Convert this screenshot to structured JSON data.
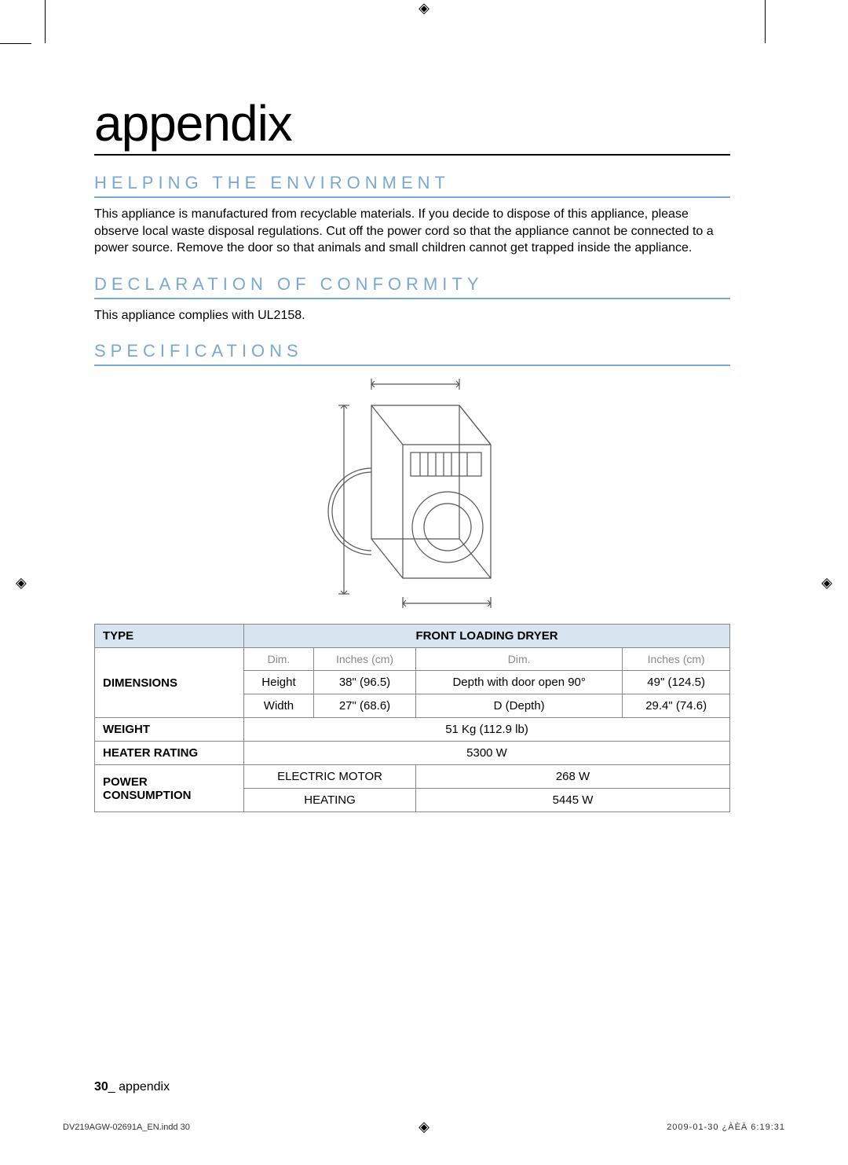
{
  "title": "appendix",
  "sections": {
    "env": {
      "heading": "HELPING THE ENVIRONMENT",
      "body": "This appliance is manufactured from recyclable materials. If you decide to dispose of this appliance, please observe local waste disposal regulations. Cut off the power cord so that the appliance cannot be connected to a power source. Remove the door so that animals and small children cannot get trapped inside the appliance."
    },
    "decl": {
      "heading": "DECLARATION OF CONFORMITY",
      "body": "This appliance complies with UL2158."
    },
    "spec": {
      "heading": "SPECIFICATIONS"
    }
  },
  "table": {
    "type_label": "TYPE",
    "type_value": "FRONT LOADING DRYER",
    "dim_label": "DIMENSIONS",
    "unit_prefix_a": "Dim.",
    "unit_col_a": "Inches (cm)",
    "unit_prefix_b": "Dim.",
    "unit_col_b": "Inches (cm)",
    "r1a": "Height",
    "r1b": "38\" (96.5)",
    "r1c": "Depth with door open 90°",
    "r1d": "49\" (124.5)",
    "r2a": "Width",
    "r2b": "27\" (68.6)",
    "r2c": "D (Depth)",
    "r2d": "29.4\" (74.6)",
    "weight_label": "WEIGHT",
    "weight_value": "51 Kg (112.9 lb)",
    "heater_label": "HEATER RATING",
    "heater_value": "5300 W",
    "power_label": "POWER CONSUMPTION",
    "p1a": "ELECTRIC MOTOR",
    "p1b": "268 W",
    "p2a": "HEATING",
    "p2b": "5445 W"
  },
  "footer": {
    "page_num": "30",
    "section": "_ appendix"
  },
  "print": {
    "left": "DV219AGW-02691A_EN.indd   30",
    "right": "2009-01-30   ¿ÀÈÄ 6:19:31"
  },
  "reg_glyph": "◈"
}
